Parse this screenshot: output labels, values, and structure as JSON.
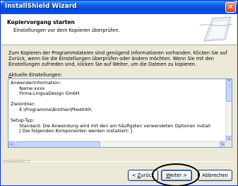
{
  "window": {
    "title": "InstallShield Wizard",
    "close_glyph": "✕"
  },
  "header": {
    "title": "Kopiervorgang starten",
    "subtitle": "Einstellungen vor dem Kopieren überprüfen."
  },
  "intro_text": "Zum Kopieren der Programmdateien sind genügend Informationen vorhanden. Klicken Sie auf Zurück, wenn Sie die Einstellungen überprüfen oder ändern möchten. Wenn Sie mit den Einstellungen zufrieden sind, klicken Sie auf Weiter, um die Dateien zu kopieren.",
  "settings_label": {
    "accel": "A",
    "rest": "ktuelle Einstellungen:"
  },
  "settings_text": "Anwenderinformation:\n      Name:xxxx\n      Firma:LinguaDesign GmbH\n\nZielordner:\n      E:\\Programme\\Brother\\Ptedit40\\\n\nSetup-Typ:\n      Standard: Die Anwendung wird mit den am häufigsten verwendeten Optionen install\n      [ Die folgenden Komponenten werden installiert: ]",
  "brand": "InstallShield",
  "buttons": {
    "back": {
      "prefix": "< ",
      "accel": "Z",
      "rest": "urück"
    },
    "next": {
      "accel": "W",
      "rest": "eiter >"
    },
    "cancel": "Abbrechen"
  },
  "scrollbar_glyphs": {
    "up": "^",
    "down": "v",
    "left": "<",
    "right": ">"
  },
  "colors": {
    "title_bar": "#0a5fe3",
    "highlight_ellipse": "#000000"
  }
}
